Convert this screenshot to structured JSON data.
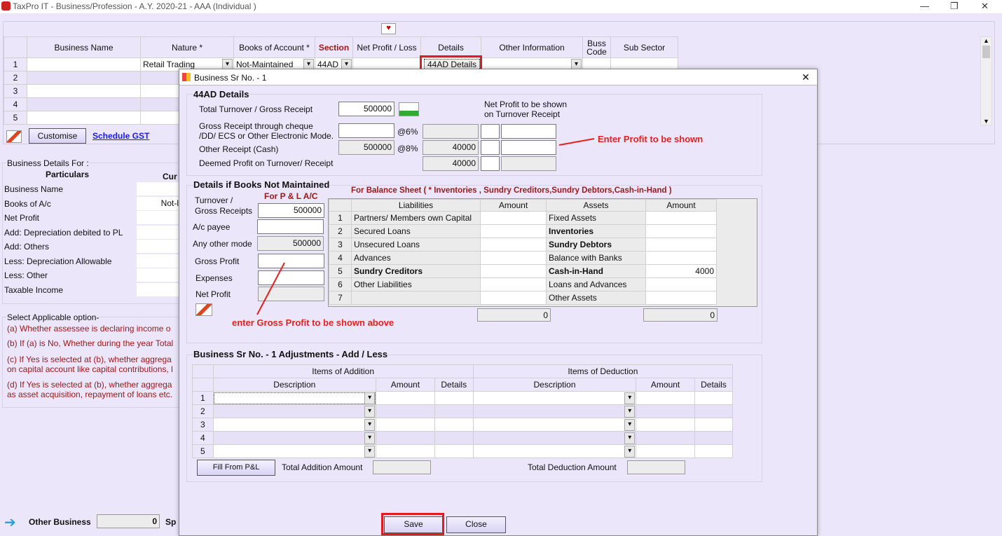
{
  "window": {
    "title": "TaxPro IT - Business/Profession - A.Y. 2020-21 - AAA   (Individual )",
    "min": "—",
    "restore": "❐",
    "close": "✕"
  },
  "main_grid": {
    "headers": [
      "",
      "Business Name",
      "Nature *",
      "Books of Account *",
      "Section",
      "Net Profit / Loss",
      "Details",
      "Other Information",
      "Buss Code",
      "Sub Sector"
    ],
    "rows": [
      {
        "no": "1",
        "name": "",
        "nature": "Retail Trading",
        "books": "Not-Maintained",
        "section": "44AD",
        "net_profit": "",
        "details": "44AD Details",
        "other": ""
      },
      {
        "no": "2"
      },
      {
        "no": "3"
      },
      {
        "no": "4"
      },
      {
        "no": "5"
      }
    ]
  },
  "toolbar": {
    "customise": "Customise",
    "schedule_gst": "Schedule GST"
  },
  "business_details": {
    "title": "Business Details For :",
    "col_particulars": "Particulars",
    "col_current": "Cur",
    "items": [
      {
        "label": "Business Name",
        "value": ""
      },
      {
        "label": "Books of A/c",
        "value": "Not-l"
      },
      {
        "label": "Net Profit",
        "value": ""
      },
      {
        "label": "Add: Depreciation debited to PL",
        "value": ""
      },
      {
        "label": "Add: Others",
        "value": ""
      },
      {
        "label": "Less: Depreciation Allowable",
        "value": ""
      },
      {
        "label": "Less: Other",
        "value": ""
      },
      {
        "label": "Taxable Income",
        "value": ""
      }
    ]
  },
  "applicable": {
    "title": "Select Applicable option-",
    "lines": [
      "(a) Whether assessee is declaring income o",
      "(b) If (a) is No, Whether during the year Total",
      "(c)  If Yes is selected at (b), whether aggrega",
      "on capital account like capital contributions, l",
      "(d)  If Yes is selected at (b), whether aggrega",
      "as asset acquisition, repayment of loans etc."
    ]
  },
  "other_business": {
    "label": "Other Business",
    "value": "0",
    "next": "Sp"
  },
  "dialog": {
    "title": "Business Sr No. - 1",
    "close": "✕",
    "ad44": {
      "title": "44AD Details",
      "turnover_label": "Total Turnover  / Gross Receipt",
      "turnover": "500000",
      "np_header": "Net Profit to be shown\non Turnover Receipt",
      "cheque_label": "Gross Receipt through cheque\n/DD/ ECS or Other Electronic Mode.",
      "cheque": "",
      "rate6": "@6%",
      "cheque_profit": "",
      "cash_label": "Other Receipt (Cash)",
      "cash": "500000",
      "rate8": "@8%",
      "cash_profit": "40000",
      "deemed_label": "Deemed Profit on Turnover/ Receipt",
      "deemed": "40000"
    },
    "annotation_profit": "Enter Profit to be shown",
    "books": {
      "title": "Details if Books Not Maintained",
      "pl_title": "For P & L A/C",
      "turnover_label": "Turnover /\nGross Receipts",
      "turnover": "500000",
      "acpayee_label": "A/c payee",
      "acpayee": "",
      "othermode_label": "Any other mode",
      "othermode": "500000",
      "gp_label": "Gross Profit",
      "gp": "",
      "exp_label": "Expenses",
      "exp": "",
      "np_label": "Net Profit",
      "np": ""
    },
    "balance_sheet": {
      "title": "For Balance Sheet ( * Inventories , Sundry Creditors,Sundry Debtors,Cash-in-Hand )",
      "headers": [
        "",
        "Liabilities",
        "Amount",
        "Assets",
        "Amount"
      ],
      "rows": [
        {
          "no": "1",
          "liab": "Partners/ Members own Capital",
          "lamt": "",
          "asset": "Fixed Assets",
          "aamt": ""
        },
        {
          "no": "2",
          "liab": "Secured Loans",
          "lamt": "",
          "asset": "Inventories",
          "aamt": "",
          "abold": true
        },
        {
          "no": "3",
          "liab": "Unsecured Loans",
          "lamt": "",
          "asset": "Sundry Debtors",
          "aamt": "",
          "abold": true
        },
        {
          "no": "4",
          "liab": "Advances",
          "lamt": "",
          "asset": "Balance with Banks",
          "aamt": ""
        },
        {
          "no": "5",
          "liab": "Sundry Creditors",
          "lamt": "",
          "asset": "Cash-in-Hand",
          "aamt": "4000",
          "lbold": true,
          "abold": true
        },
        {
          "no": "6",
          "liab": "Other Liabilities",
          "lamt": "",
          "asset": "Loans and Advances",
          "aamt": ""
        },
        {
          "no": "7",
          "liab": "",
          "lamt": "",
          "asset": "Other Assets",
          "aamt": ""
        }
      ],
      "total_liab": "0",
      "total_assets": "0"
    },
    "annotation_gp": "enter Gross Profit to be shown above",
    "adjust": {
      "title": "Business Sr No. - 1  Adjustments - Add / Less",
      "addition": "Items of Addition",
      "deduction": "Items of Deduction",
      "cols": [
        "Description",
        "Amount",
        "Details",
        "Description",
        "Amount",
        "Details"
      ],
      "rows": [
        "1",
        "2",
        "3",
        "4",
        "5"
      ],
      "fill": "Fill From P&L",
      "total_add_label": "Total Addition Amount",
      "total_add": "",
      "total_ded_label": "Total Deduction Amount",
      "total_ded": ""
    },
    "save": "Save",
    "close_btn": "Close"
  },
  "colors": {
    "background": "#ebe6fa",
    "highlight": "#e01b24",
    "label_red": "#a01818"
  }
}
